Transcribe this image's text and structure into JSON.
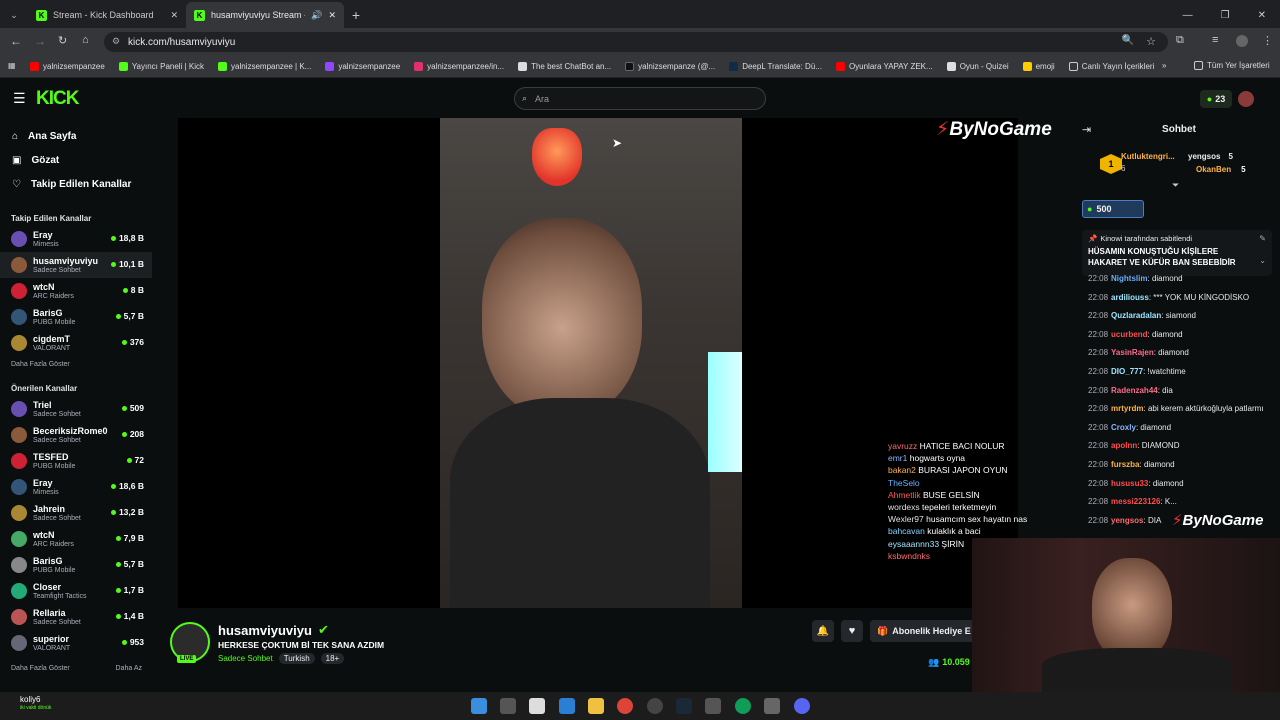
{
  "browser": {
    "tabs": [
      {
        "title": "Stream - Kick Dashboard"
      },
      {
        "title": "husamviyuviyu Stream - W"
      }
    ],
    "url": "kick.com/husamviyuviyu",
    "bookmarks": [
      "yalnizsempanzee",
      "Yayıncı Paneli | Kick",
      "yalnizsempanzee | K...",
      "yalnizsempanzee",
      "yalnizsempanzee/in...",
      "The best ChatBot an...",
      "yalnizsempanze (@...",
      "DeepL Translate: Dü...",
      "Oyunlara YAPAY ZEK...",
      "Oyun - Quizei",
      "emoji",
      "Canlı Yayın İçerikleri"
    ],
    "bookmarks_right": "Tüm Yer İşaretleri"
  },
  "kick": {
    "search_placeholder": "Ara",
    "kicks_count": "23",
    "nav": [
      "Ana Sayfa",
      "Gözat",
      "Takip Edilen Kanallar"
    ],
    "followed_header": "Takip Edilen Kanallar",
    "followed": [
      {
        "name": "Eray",
        "game": "Mimesis",
        "viewers": "18,8 B"
      },
      {
        "name": "husamviyuviyu",
        "game": "Sadece Sohbet",
        "viewers": "10,1 B"
      },
      {
        "name": "wtcN",
        "game": "ARC Raiders",
        "viewers": "8 B"
      },
      {
        "name": "BarisG",
        "game": "PUBG Mobile",
        "viewers": "5,7 B"
      },
      {
        "name": "cigdemT",
        "game": "VALORANT",
        "viewers": "376"
      }
    ],
    "show_more": "Daha Fazla Göster",
    "recommended_header": "Önerilen Kanallar",
    "recommended": [
      {
        "name": "Triel",
        "game": "Sadece Sohbet",
        "viewers": "509"
      },
      {
        "name": "BeceriksizRome0",
        "game": "Sadece Sohbet",
        "viewers": "208"
      },
      {
        "name": "TESFED",
        "game": "PUBG Mobile",
        "viewers": "72"
      },
      {
        "name": "Eray",
        "game": "Mimesis",
        "viewers": "18,6 B"
      },
      {
        "name": "Jahrein",
        "game": "Sadece Sohbet",
        "viewers": "13,2 B"
      },
      {
        "name": "wtcN",
        "game": "ARC Raiders",
        "viewers": "7,9 B"
      },
      {
        "name": "BarisG",
        "game": "PUBG Mobile",
        "viewers": "5,7 B"
      },
      {
        "name": "Closer",
        "game": "Teamfight Tactics",
        "viewers": "1,7 B"
      },
      {
        "name": "Rellaria",
        "game": "Sadece Sohbet",
        "viewers": "1,4 B"
      },
      {
        "name": "superior",
        "game": "VALORANT",
        "viewers": "953"
      }
    ],
    "show_less": "Daha Az",
    "stream": {
      "channel": "husamviyuviyu",
      "title": "HERKESE ÇOKTUM Bİ TEK SANA AZDIM",
      "category": "Sadece Sohbet",
      "tags": [
        "Turkish",
        "18+"
      ],
      "live_label": "LIVE",
      "subscribe_gift": "Abonelik Hediye E",
      "viewers": "10.059"
    },
    "overlay_chat": [
      {
        "user": "yavruzz",
        "text": "HATICE BACI NOLUR",
        "color": "#ff6a6a"
      },
      {
        "user": "emr1",
        "text": "hogwarts oyna",
        "color": "#8ab4ff"
      },
      {
        "user": "bakan2",
        "text": "BURASI JAPON OYUN",
        "color": "#ffb347"
      },
      {
        "user": "TheSelo",
        "text": "",
        "color": "#6ab0ff"
      },
      {
        "user": "Ahmetlik",
        "text": "BUSE GELSİN",
        "color": "#ff5a5a"
      },
      {
        "user": "wordexs",
        "text": "tepeleri terketmeyin",
        "color": "#e0e0e0"
      },
      {
        "user": "Wexler97",
        "text": "husamcım sex hayatın nasıl canım",
        "color": "#e0e0e0"
      },
      {
        "user": "bahcavan",
        "text": "kulaklık a baci",
        "color": "#7fd6ff"
      },
      {
        "user": "eysaaannn33",
        "text": "ŞİRİN",
        "color": "#9fe6ff"
      },
      {
        "user": "ksbwndnks",
        "text": "",
        "color": "#ff6a6a"
      }
    ],
    "brand_overlay": "ByNoGame",
    "chat": {
      "title": "Sohbet",
      "leaders": [
        {
          "name": "Kutluktengri...",
          "count": "6"
        },
        {
          "name": "yengsos",
          "count": "5"
        },
        {
          "name": "OkanBen",
          "count": "5"
        }
      ],
      "points": "500",
      "pinned_by": "Kinowi tarafından sabitlendi",
      "pinned_text": "HÜSAMIN KONUŞTUĞU KİŞİLERE HAKARET VE KÜFÜR BAN SEBEBİDİR",
      "messages": [
        {
          "time": "22:08",
          "user": "Nightslim",
          "text": "diamond",
          "color": "#6ab0ff"
        },
        {
          "time": "22:08",
          "user": "ardiliouss",
          "text": "*** YOK MU KİNGODİSKO",
          "color": "#9fe6ff"
        },
        {
          "time": "22:08",
          "user": "Quzlaradalan",
          "text": "siamond",
          "color": "#9fe6ff"
        },
        {
          "time": "22:08",
          "user": "ucurbend",
          "text": "diamond",
          "color": "#ff4d4d"
        },
        {
          "time": "22:08",
          "user": "YasinRajen",
          "text": "diamond",
          "color": "#ff6a8a"
        },
        {
          "time": "22:08",
          "user": "DIO_777",
          "text": "!watchtime",
          "color": "#9fe6ff"
        },
        {
          "time": "22:08",
          "user": "Radenzah44",
          "text": "dia",
          "color": "#ff6a8a"
        },
        {
          "time": "22:08",
          "user": "mrtyrdm",
          "text": "abi kerem aktürkoğluyla patlarmı",
          "color": "#ffb347"
        },
        {
          "time": "22:08",
          "user": "Croxly",
          "text": "diamond",
          "color": "#8ab4ff"
        },
        {
          "time": "22:08",
          "user": "apolnn",
          "text": "DIAMOND",
          "color": "#ff4d4d"
        },
        {
          "time": "22:08",
          "user": "furszba",
          "text": "diamond",
          "color": "#ffb347"
        },
        {
          "time": "22:08",
          "user": "hususu33",
          "text": "diamond",
          "color": "#ff4d4d"
        },
        {
          "time": "22:08",
          "user": "messi223126",
          "text": "K...",
          "color": "#ff4d4d"
        },
        {
          "time": "22:08",
          "user": "yengsos",
          "text": "DIA",
          "color": "#ff6a6a"
        }
      ]
    }
  },
  "taskbar": {
    "user": "koliy6",
    "user_sub": "iki vakti dönük"
  },
  "colors": {
    "kick_green": "#53fc18",
    "bg": "#0b0e0f"
  }
}
